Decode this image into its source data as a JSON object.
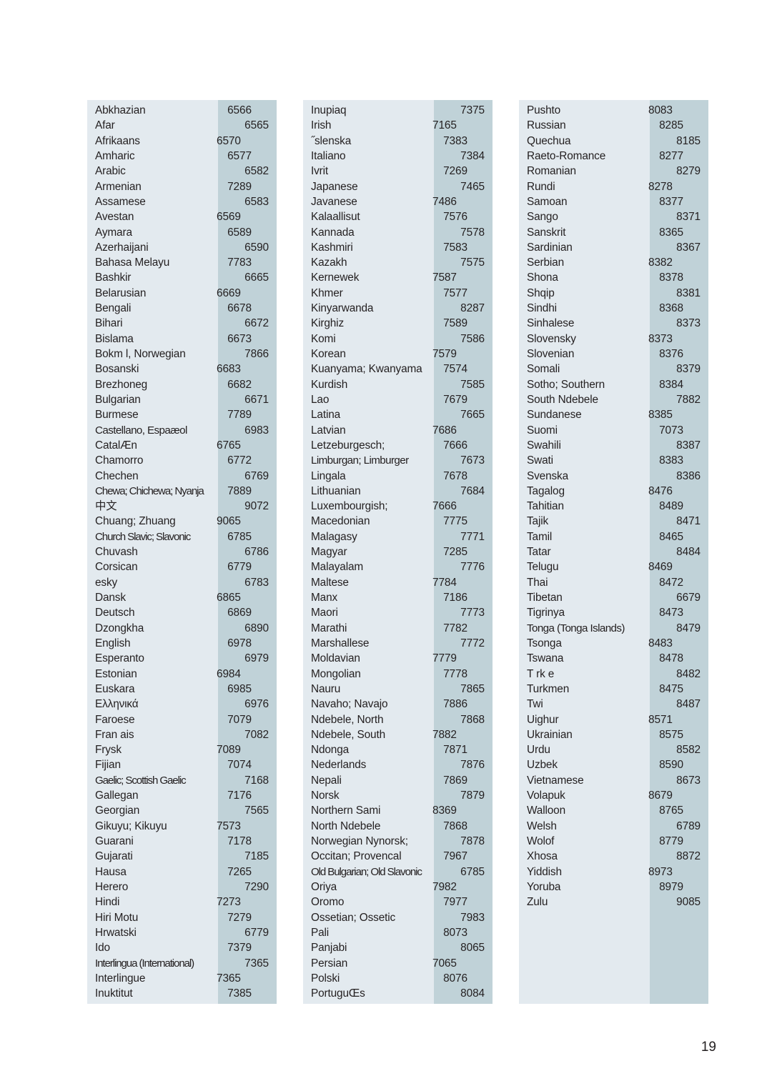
{
  "document": {
    "page_number": "19",
    "columns": [
      {
        "id": "column-1",
        "entries": [
          {
            "language": "Abkhazian",
            "code": "6566"
          },
          {
            "language": "Afar",
            "code": "6565"
          },
          {
            "language": "Afrikaans",
            "code": "6570"
          },
          {
            "language": "Amharic",
            "code": "6577"
          },
          {
            "language": "Arabic",
            "code": "6582"
          },
          {
            "language": "Armenian",
            "code": "7289"
          },
          {
            "language": "Assamese",
            "code": "6583"
          },
          {
            "language": "Avestan",
            "code": "6569"
          },
          {
            "language": "Aymara",
            "code": "6589"
          },
          {
            "language": "Azerhaijani",
            "code": "6590"
          },
          {
            "language": "Bahasa Melayu",
            "code": "7783"
          },
          {
            "language": "Bashkir",
            "code": "6665"
          },
          {
            "language": "Belarusian",
            "code": "6669"
          },
          {
            "language": "Bengali",
            "code": "6678"
          },
          {
            "language": "Bihari",
            "code": "6672"
          },
          {
            "language": "Bislama",
            "code": "6673"
          },
          {
            "language": "Bokm l, Norwegian",
            "code": "7866"
          },
          {
            "language": "Bosanski",
            "code": "6683"
          },
          {
            "language": "Brezhoneg",
            "code": "6682"
          },
          {
            "language": "Bulgarian",
            "code": "6671"
          },
          {
            "language": "Burmese",
            "code": "7789"
          },
          {
            "language": "Castellano, Espaæol",
            "code": "6983"
          },
          {
            "language": "CatalÆn",
            "code": "6765"
          },
          {
            "language": "Chamorro",
            "code": "6772"
          },
          {
            "language": "Chechen",
            "code": "6769"
          },
          {
            "language": "Chewa; Chichewa; Nyanja",
            "code": "7889"
          },
          {
            "language": "中文",
            "code": "9072"
          },
          {
            "language": "Chuang; Zhuang",
            "code": "9065"
          },
          {
            "language": "Church Slavic; Slavonic",
            "code": "6785"
          },
          {
            "language": "Chuvash",
            "code": "6786"
          },
          {
            "language": "Corsican",
            "code": "6779"
          },
          {
            "language": " esky",
            "code": "6783"
          },
          {
            "language": "Dansk",
            "code": "6865"
          },
          {
            "language": "Deutsch",
            "code": "6869"
          },
          {
            "language": "Dzongkha",
            "code": "6890"
          },
          {
            "language": "English",
            "code": "6978"
          },
          {
            "language": "Esperanto",
            "code": "6979"
          },
          {
            "language": "Estonian",
            "code": "6984"
          },
          {
            "language": "Euskara",
            "code": "6985"
          },
          {
            "language": "Ελληνικά",
            "code": "6976"
          },
          {
            "language": "Faroese",
            "code": "7079"
          },
          {
            "language": "Fran ais",
            "code": "7082"
          },
          {
            "language": "Frysk",
            "code": "7089"
          },
          {
            "language": "Fijian",
            "code": "7074"
          },
          {
            "language": "Gaelic; Scottish Gaelic",
            "code": "7168"
          },
          {
            "language": "Gallegan",
            "code": "7176"
          },
          {
            "language": "Georgian",
            "code": "7565"
          },
          {
            "language": "Gikuyu; Kikuyu",
            "code": "7573"
          },
          {
            "language": "Guarani",
            "code": "7178"
          },
          {
            "language": "Gujarati",
            "code": "7185"
          },
          {
            "language": "Hausa",
            "code": "7265"
          },
          {
            "language": "Herero",
            "code": "7290"
          },
          {
            "language": "Hindi",
            "code": "7273"
          },
          {
            "language": "Hiri Motu",
            "code": "7279"
          },
          {
            "language": "Hrwatski",
            "code": "6779"
          },
          {
            "language": "Ido",
            "code": "7379"
          },
          {
            "language": "Interlingua (International)",
            "code": "7365"
          },
          {
            "language": "Interlingue",
            "code": "7365"
          },
          {
            "language": "Inuktitut",
            "code": "7385"
          }
        ]
      },
      {
        "id": "column-2",
        "entries": [
          {
            "language": "Inupiaq",
            "code": "7375"
          },
          {
            "language": "Irish",
            "code": "7165"
          },
          {
            "language": "˝slenska",
            "code": "7383"
          },
          {
            "language": "Italiano",
            "code": "7384"
          },
          {
            "language": "Ivrit",
            "code": "7269"
          },
          {
            "language": "Japanese",
            "code": "7465"
          },
          {
            "language": "Javanese",
            "code": "7486"
          },
          {
            "language": "Kalaallisut",
            "code": "7576"
          },
          {
            "language": "Kannada",
            "code": "7578"
          },
          {
            "language": "Kashmiri",
            "code": "7583"
          },
          {
            "language": "Kazakh",
            "code": "7575"
          },
          {
            "language": "Kernewek",
            "code": "7587"
          },
          {
            "language": "Khmer",
            "code": "7577"
          },
          {
            "language": "Kinyarwanda",
            "code": "8287"
          },
          {
            "language": "Kirghiz",
            "code": "7589"
          },
          {
            "language": "Komi",
            "code": "7586"
          },
          {
            "language": "Korean",
            "code": "7579"
          },
          {
            "language": "Kuanyama; Kwanyama",
            "code": "7574"
          },
          {
            "language": "Kurdish",
            "code": "7585"
          },
          {
            "language": "Lao",
            "code": "7679"
          },
          {
            "language": "Latina",
            "code": "7665"
          },
          {
            "language": "Latvian",
            "code": "7686"
          },
          {
            "language": "Letzeburgesch;",
            "code": "7666"
          },
          {
            "language": "Limburgan; Limburger",
            "code": "7673"
          },
          {
            "language": "Lingala",
            "code": "7678"
          },
          {
            "language": "Lithuanian",
            "code": "7684"
          },
          {
            "language": "Luxembourgish;",
            "code": "7666"
          },
          {
            "language": "Macedonian",
            "code": "7775"
          },
          {
            "language": "Malagasy",
            "code": "7771"
          },
          {
            "language": "Magyar",
            "code": "7285"
          },
          {
            "language": "Malayalam",
            "code": "7776"
          },
          {
            "language": "Maltese",
            "code": "7784"
          },
          {
            "language": "Manx",
            "code": "7186"
          },
          {
            "language": "Maori",
            "code": "7773"
          },
          {
            "language": "Marathi",
            "code": "7782"
          },
          {
            "language": "Marshallese",
            "code": "7772"
          },
          {
            "language": "Moldavian",
            "code": "7779"
          },
          {
            "language": "Mongolian",
            "code": "7778"
          },
          {
            "language": "Nauru",
            "code": "7865"
          },
          {
            "language": "Navaho; Navajo",
            "code": "7886"
          },
          {
            "language": "Ndebele, North",
            "code": "7868"
          },
          {
            "language": "Ndebele, South",
            "code": "7882"
          },
          {
            "language": "Ndonga",
            "code": "7871"
          },
          {
            "language": "Nederlands",
            "code": "7876"
          },
          {
            "language": "Nepali",
            "code": "7869"
          },
          {
            "language": "Norsk",
            "code": "7879"
          },
          {
            "language": "Northern Sami",
            "code": "8369"
          },
          {
            "language": "North Ndebele",
            "code": "7868"
          },
          {
            "language": "Norwegian Nynorsk;",
            "code": "7878"
          },
          {
            "language": "Occitan; Provencal",
            "code": "7967"
          },
          {
            "language": "Old Bulgarian; Old Slavonic",
            "code": "6785"
          },
          {
            "language": "Oriya",
            "code": "7982"
          },
          {
            "language": "Oromo",
            "code": "7977"
          },
          {
            "language": "Ossetian; Ossetic",
            "code": "7983"
          },
          {
            "language": "Pali",
            "code": "8073"
          },
          {
            "language": "Panjabi",
            "code": "8065"
          },
          {
            "language": "Persian",
            "code": "7065"
          },
          {
            "language": "Polski",
            "code": "8076"
          },
          {
            "language": "PortuguŒs",
            "code": "8084"
          }
        ]
      },
      {
        "id": "column-3",
        "entries": [
          {
            "language": "Pushto",
            "code": "8083"
          },
          {
            "language": "Russian",
            "code": "8285"
          },
          {
            "language": "Quechua",
            "code": "8185"
          },
          {
            "language": "Raeto-Romance",
            "code": "8277"
          },
          {
            "language": "Romanian",
            "code": "8279"
          },
          {
            "language": "Rundi",
            "code": "8278"
          },
          {
            "language": "Samoan",
            "code": "8377"
          },
          {
            "language": "Sango",
            "code": "8371"
          },
          {
            "language": "Sanskrit",
            "code": "8365"
          },
          {
            "language": "Sardinian",
            "code": "8367"
          },
          {
            "language": "Serbian",
            "code": "8382"
          },
          {
            "language": "Shona",
            "code": "8378"
          },
          {
            "language": "Shqip",
            "code": "8381"
          },
          {
            "language": "Sindhi",
            "code": "8368"
          },
          {
            "language": "Sinhalese",
            "code": "8373"
          },
          {
            "language": "Slovensky",
            "code": "8373"
          },
          {
            "language": "Slovenian",
            "code": "8376"
          },
          {
            "language": "Somali",
            "code": "8379"
          },
          {
            "language": "Sotho; Southern",
            "code": "8384"
          },
          {
            "language": "South Ndebele",
            "code": "7882"
          },
          {
            "language": "Sundanese",
            "code": "8385"
          },
          {
            "language": "Suomi",
            "code": "7073"
          },
          {
            "language": "Swahili",
            "code": "8387"
          },
          {
            "language": "Swati",
            "code": "8383"
          },
          {
            "language": "Svenska",
            "code": "8386"
          },
          {
            "language": "Tagalog",
            "code": "8476"
          },
          {
            "language": "Tahitian",
            "code": "8489"
          },
          {
            "language": "Tajik",
            "code": "8471"
          },
          {
            "language": "Tamil",
            "code": "8465"
          },
          {
            "language": "Tatar",
            "code": "8484"
          },
          {
            "language": "Telugu",
            "code": "8469"
          },
          {
            "language": "Thai",
            "code": "8472"
          },
          {
            "language": "Tibetan",
            "code": "6679"
          },
          {
            "language": "Tigrinya",
            "code": "8473"
          },
          {
            "language": "Tonga (Tonga Islands)",
            "code": "8479"
          },
          {
            "language": "Tsonga",
            "code": "8483"
          },
          {
            "language": "Tswana",
            "code": "8478"
          },
          {
            "language": "T rk e",
            "code": "8482"
          },
          {
            "language": "Turkmen",
            "code": "8475"
          },
          {
            "language": "Twi",
            "code": "8487"
          },
          {
            "language": "Uighur",
            "code": "8571"
          },
          {
            "language": "Ukrainian",
            "code": "8575"
          },
          {
            "language": "Urdu",
            "code": "8582"
          },
          {
            "language": "Uzbek",
            "code": "8590"
          },
          {
            "language": "Vietnamese",
            "code": "8673"
          },
          {
            "language": "Volapuk",
            "code": "8679"
          },
          {
            "language": "Walloon",
            "code": "8765"
          },
          {
            "language": "Welsh",
            "code": "6789"
          },
          {
            "language": "Wolof",
            "code": "8779"
          },
          {
            "language": "Xhosa",
            "code": "8872"
          },
          {
            "language": "Yiddish",
            "code": "8973"
          },
          {
            "language": "Yoruba",
            "code": "8979"
          },
          {
            "language": "Zulu",
            "code": "9085"
          }
        ]
      }
    ]
  },
  "colors": {
    "panel_background": "#e3eaef",
    "code_band_background": "#c0d2d8",
    "text": "#231f20",
    "page_background": "#ffffff"
  }
}
